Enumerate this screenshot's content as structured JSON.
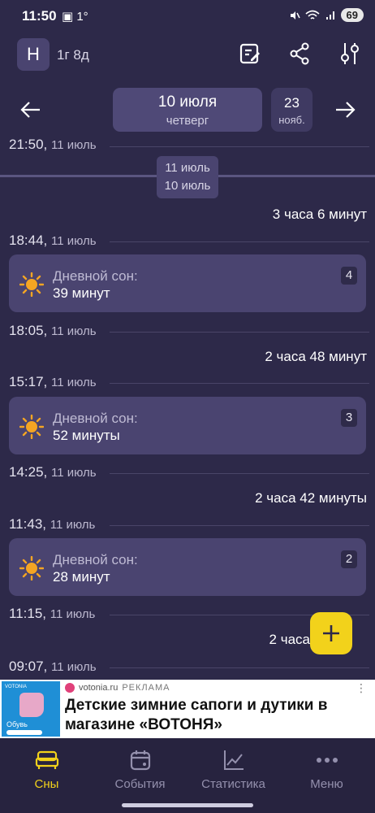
{
  "status_bar": {
    "time": "11:50",
    "left_extra": "▣ 1°",
    "battery": "69"
  },
  "header": {
    "avatar_letter": "Н",
    "age": "1г 8д"
  },
  "date_nav": {
    "current_date": "10 июля",
    "current_weekday": "четверг",
    "next_day": "23",
    "next_month": "нояб."
  },
  "timeline": {
    "night_chip": {
      "line1": "11 июль",
      "line2": "10 июль"
    },
    "entries": [
      {
        "time": "21:50,",
        "date": "11 июль"
      },
      {
        "duration": "3 часа 6 минут"
      },
      {
        "time": "18:44,",
        "date": "11 июль"
      },
      {
        "card_label": "Дневной сон:",
        "card_value": "39 минут",
        "badge": "4"
      },
      {
        "time": "18:05,",
        "date": "11 июль"
      },
      {
        "duration": "2 часа 48 минут"
      },
      {
        "time": "15:17,",
        "date": "11 июль"
      },
      {
        "card_label": "Дневной сон:",
        "card_value": "52 минуты",
        "badge": "3"
      },
      {
        "time": "14:25,",
        "date": "11 июль"
      },
      {
        "duration": "2 часа 42 минуты"
      },
      {
        "time": "11:43,",
        "date": "11 июль"
      },
      {
        "card_label": "Дневной сон:",
        "card_value": "28 минут",
        "badge": "2"
      },
      {
        "time": "11:15,",
        "date": "11 июль"
      },
      {
        "duration": "2 часа"
      },
      {
        "time": "09:07,",
        "date": "11 июль"
      }
    ]
  },
  "ad": {
    "image_caption": "Обувь",
    "image_brand": "VOTONIA",
    "source": "votonia.ru",
    "sponsor": "РЕКЛАМА",
    "title": "Детские зимние сапоги и дутики в магазине «ВОТОНЯ»"
  },
  "bottom_nav": [
    {
      "label": "Сны",
      "icon": "bed-icon",
      "active": true
    },
    {
      "label": "События",
      "icon": "calendar-icon",
      "active": false
    },
    {
      "label": "Статистика",
      "icon": "chart-icon",
      "active": false
    },
    {
      "label": "Меню",
      "icon": "more-dots-icon",
      "active": false
    }
  ],
  "colors": {
    "background": "#2d2949",
    "card": "#4a4470",
    "accent": "#f2d21b"
  }
}
